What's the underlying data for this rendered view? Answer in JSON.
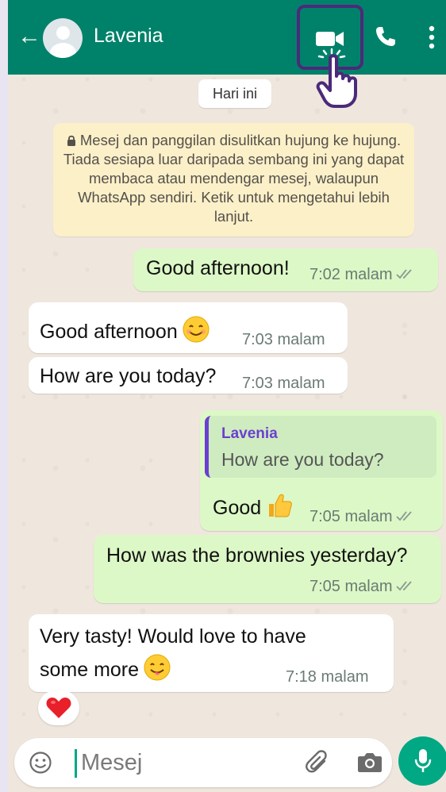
{
  "colors": {
    "header": "#00826a",
    "outgoing_bubble": "#dcf8c6",
    "incoming_bubble": "#ffffff",
    "accent": "#00a884",
    "highlight": "#4b2a7a",
    "quote_name": "#6a3fd1"
  },
  "header": {
    "back_glyph": "←",
    "contact_name": "Lavenia",
    "icons": [
      "back-arrow-icon",
      "avatar",
      "video-call-icon",
      "voice-call-icon",
      "more-options-icon"
    ]
  },
  "chat": {
    "date_chip": "Hari ini",
    "encryption_notice": "Mesej dan panggilan disulitkan hujung ke hujung. Tiada sesiapa luar daripada sembang ini yang dapat membaca atau mendengar mesej, walaupun WhatsApp sendiri. Ketik untuk mengetahui lebih lanjut.",
    "messages": [
      {
        "direction": "out",
        "text": "Good afternoon!",
        "time": "7:02 malam",
        "status": "read"
      },
      {
        "direction": "in",
        "text": "Good afternoon",
        "emoji": "smiling-face-icon",
        "time": "7:03 malam"
      },
      {
        "direction": "in",
        "text": "How are you today?",
        "time": "7:03 malam"
      },
      {
        "direction": "out",
        "quote": {
          "name": "Lavenia",
          "text": "How are you today?"
        },
        "text": "Good",
        "emoji": "thumbs-up-icon",
        "time": "7:05 malam",
        "status": "read"
      },
      {
        "direction": "out",
        "text": "How was the brownies yesterday?",
        "time": "7:05 malam",
        "status": "read"
      },
      {
        "direction": "in",
        "text_line1": "Very tasty! Would love to have",
        "text_line2": "some more",
        "emoji": "yum-face-icon",
        "time": "7:18 malam",
        "reaction": "heart"
      }
    ]
  },
  "composer": {
    "placeholder": "Mesej",
    "icons": [
      "emoji-icon",
      "attach-icon",
      "camera-icon",
      "mic-icon"
    ]
  }
}
